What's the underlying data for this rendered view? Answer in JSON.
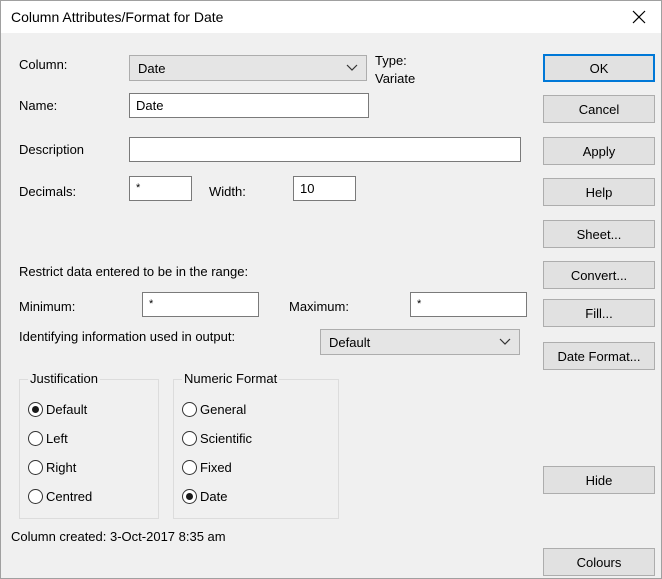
{
  "window": {
    "title": "Column Attributes/Format for Date"
  },
  "form": {
    "column_label": "Column:",
    "column_value": "Date",
    "type_label": "Type:",
    "type_value": "Variate",
    "name_label": "Name:",
    "name_value": "Date",
    "description_label": "Description",
    "description_value": "",
    "decimals_label": "Decimals:",
    "decimals_value": "*",
    "width_label": "Width:",
    "width_value": "10",
    "restrict_label": "Restrict data entered to be in the range:",
    "minimum_label": "Minimum:",
    "minimum_value": "*",
    "maximum_label": "Maximum:",
    "maximum_value": "*",
    "identifying_label": "Identifying information used in output:",
    "identifying_value": "Default"
  },
  "justification": {
    "title": "Justification",
    "options": [
      "Default",
      "Left",
      "Right",
      "Centred"
    ],
    "selected": "Default"
  },
  "numeric_format": {
    "title": "Numeric Format",
    "options": [
      "General",
      "Scientific",
      "Fixed",
      "Date"
    ],
    "selected": "Date"
  },
  "status": {
    "created": "Column created: 3-Oct-2017 8:35 am"
  },
  "buttons": {
    "ok": "OK",
    "cancel": "Cancel",
    "apply": "Apply",
    "help": "Help",
    "sheet": "Sheet...",
    "convert": "Convert...",
    "fill": "Fill...",
    "date_format": "Date Format...",
    "hide": "Hide",
    "colours": "Colours"
  },
  "icons": {
    "close": "close-icon",
    "dropdown": "chevron-down-icon",
    "radio_checked": "radio-checked-icon",
    "radio_unchecked": "radio-unchecked-icon"
  },
  "colors": {
    "accent": "#0078d7",
    "dialog_bg": "#f0f0f0",
    "title_bg": "#ffffff"
  }
}
